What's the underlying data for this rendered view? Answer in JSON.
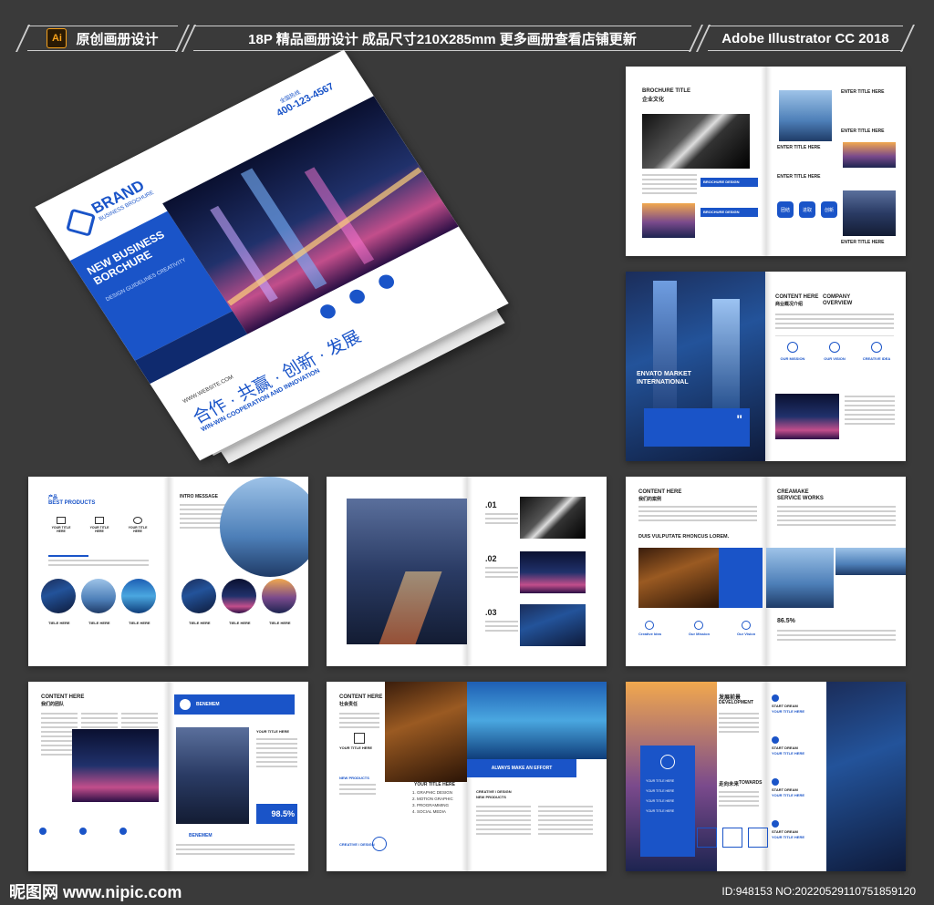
{
  "header": {
    "badge_icon": "Ai",
    "left": "原创画册设计",
    "center": "18P 精品画册设计  成品尺寸210X285mm  更多画册查看店铺更新",
    "right": "Adobe Illustrator CC 2018"
  },
  "cover": {
    "phone": "400-123-4567",
    "phone_label": "全国热线",
    "brand": "BRAND",
    "brand_sub": "BUSINESS BROCHURE",
    "title": "NEW BUSINESS BORCHURE",
    "subtitle": "DESIGN GUIDELINES CREATIVITY",
    "website": "WWW.WEBSITE.COM",
    "slogan_cn": "合作 · 共赢 · 创新 · 发展",
    "slogan_en": "WIN-WIN COOPERATION AND INNOVATION"
  },
  "spreads": {
    "s1": {
      "title": "BROCHURE TITLE",
      "title_cn": "企业文化",
      "enter1": "ENTER TITLE HERE",
      "enter2": "ENTER TITLE HERE",
      "enter3": "ENTER TITLE HERE",
      "enter4": "ENTER TITLE HERE",
      "enter5": "ENTER TITLE HERE",
      "bd1": "BROCHURE DESIGN",
      "bd2": "BROCHURE DESIGN",
      "b1": "团结",
      "b2": "进取",
      "b3": "创新"
    },
    "s2": {
      "content": "CONTENT HERE",
      "content_cn": "商业概况介绍",
      "company": "COMPANY",
      "overview": "OVERVIEW",
      "side_title": "ENVATO MARKET INTERNATIONAL",
      "m1": "OUR MISSION",
      "m2": "OUR VISION",
      "m3": "CREATIVE IDEA"
    },
    "s3": {
      "label_cn": "产品",
      "label": "BEST PRODUCTS",
      "intro": "INTRO MESSAGE",
      "t": "YOUR TITLE HERE",
      "tiele": "TIELE HERE"
    },
    "s4": {
      "n1": ".01",
      "n2": ".02",
      "n3": ".03"
    },
    "s5": {
      "content": "CONTENT HERE",
      "content_cn": "我们的案例",
      "creamake": "CREAMAKE",
      "service": "SERVICE WORKS",
      "duis": "DUIS VULPUTATE RHONCUS LOREM.",
      "percent": "86.5%",
      "ci": "Creative Idea",
      "om": "Our Mission",
      "ov": "Our Vision"
    },
    "s6": {
      "content": "CONTENT HERE",
      "content_cn": "我们的团队",
      "benemem": "BENEMEM",
      "percent": "98.5%",
      "your_title": "YOUR TITLE HERE"
    },
    "s7": {
      "content": "CONTENT HERE",
      "content_cn": "社会责任",
      "your_title": "YOUR TITLE HERE",
      "new_products": "NEW PRODUCTS",
      "always": "ALWAYS MAKE AN EFFORT",
      "creative": "CREATIVE / DESIGN",
      "np2": "NEW PRODUCTS",
      "list": [
        "1. GRAPHIC DESIGN",
        "2. MOTION GRAPHIC",
        "3. PROGRAMMING",
        "4. SOCIAL MEDIA"
      ]
    },
    "s8": {
      "dev_cn": "发展前景",
      "dev": "DEVELOPMENT",
      "towards_cn": "走向未来",
      "towards": "TOWARDS",
      "start": "START DREAM",
      "your_title": "YOUR TITLE HERE"
    }
  },
  "footer": {
    "logo": "昵图网 www.nipic.com",
    "id": "ID:948153 NO:20220529110751859120"
  }
}
